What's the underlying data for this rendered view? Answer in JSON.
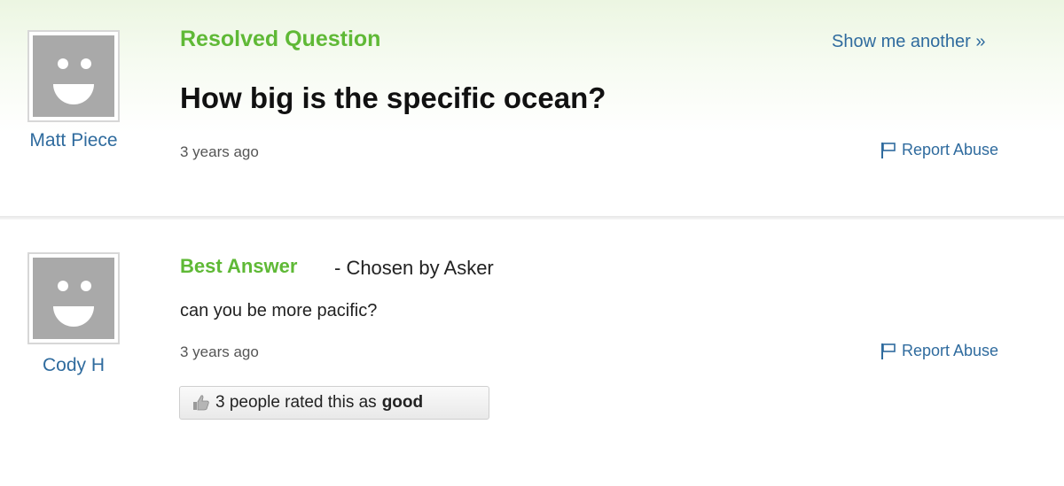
{
  "question": {
    "header": "Resolved Question",
    "title": "How big is the specific ocean?",
    "asker": "Matt Piece",
    "timestamp": "3 years ago",
    "show_another": "Show me another »",
    "report_abuse": "Report Abuse"
  },
  "answer": {
    "header": "Best Answer",
    "chosen_by": "- Chosen by Asker",
    "text": "can you be more pacific?",
    "answerer": "Cody H",
    "timestamp": "3 years ago",
    "report_abuse": "Report Abuse",
    "rating_prefix": "3 people rated this as",
    "rating_word": "good"
  },
  "colors": {
    "green_heading": "#5fb936",
    "link_blue": "#2f6b9e",
    "avatar_gray": "#a9a9a9"
  },
  "icons": [
    "avatar-smiley-icon",
    "flag-icon",
    "thumbs-up-icon",
    "double-chevron-right-icon"
  ]
}
